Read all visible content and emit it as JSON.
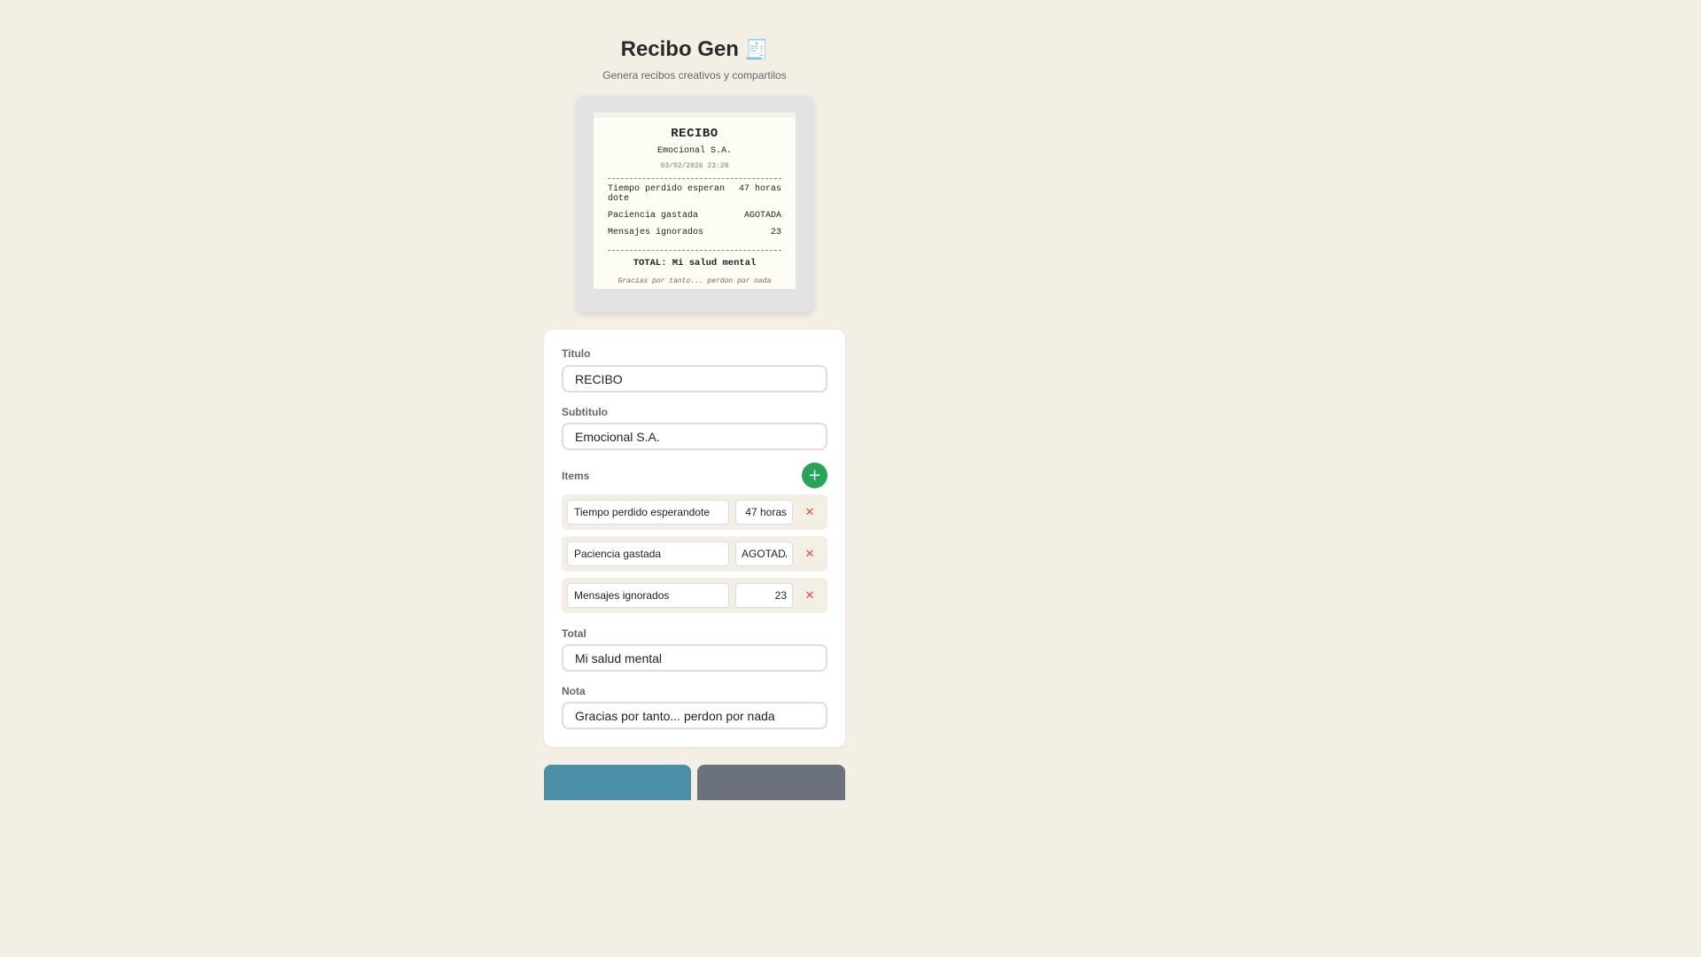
{
  "header": {
    "title": "Recibo Gen",
    "title_emoji": "🧾",
    "subtitle": "Genera recibos creativos y compartilos"
  },
  "receipt": {
    "title": "RECIBO",
    "subtitle": "Emocional S.A.",
    "date": "03/02/2026 23:28",
    "items": [
      {
        "name": "Tiempo perdido esperandote",
        "value": "47 horas"
      },
      {
        "name": "Paciencia gastada",
        "value": "AGOTADA"
      },
      {
        "name": "Mensajes ignorados",
        "value": "23"
      }
    ],
    "total": "TOTAL: Mi salud mental",
    "note": "Gracias por tanto... perdon por nada"
  },
  "form": {
    "title_label": "Titulo",
    "title_value": "RECIBO",
    "subtitle_label": "Subtitulo",
    "subtitle_value": "Emocional S.A.",
    "items_label": "Items",
    "add_icon": "+",
    "delete_icon": "✕",
    "items": [
      {
        "name": "Tiempo perdido esperandote",
        "value": "47 horas"
      },
      {
        "name": "Paciencia gastada",
        "value": "AGOTADA"
      },
      {
        "name": "Mensajes ignorados",
        "value": "23"
      }
    ],
    "total_label": "Total",
    "total_value": "Mi salud mental",
    "note_label": "Nota",
    "note_value": "Gracias por tanto... perdon por nada"
  },
  "actions": {
    "download_icon": "download-icon",
    "share_icon": "share-icon"
  },
  "colors": {
    "background": "#f4efe5",
    "add_button": "#27a35a",
    "delete_icon": "#e74c3c",
    "download_button": "#4a8fa5",
    "share_button": "#6c727c"
  }
}
